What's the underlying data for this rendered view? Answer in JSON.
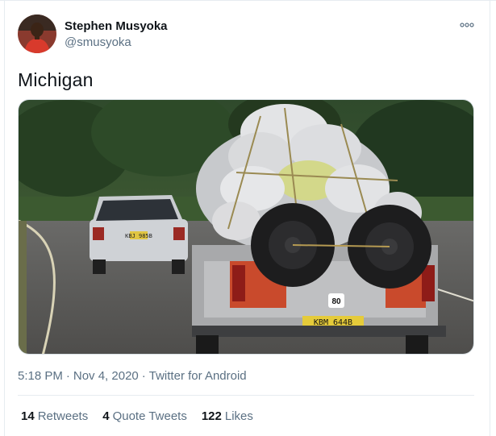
{
  "author": {
    "display_name": "Stephen Musyoka",
    "handle": "@smusyoka"
  },
  "more_icon": "ellipsis-icon",
  "tweet": {
    "text": "Michigan"
  },
  "media": {
    "plate_front_truck": "KBM 644B",
    "plate_car": "KBJ 985B",
    "speed_sticker": "80"
  },
  "meta": {
    "time": "5:18 PM",
    "separator1": "·",
    "date": "Nov 4, 2020",
    "separator2": "·",
    "source": "Twitter for Android"
  },
  "stats": [
    {
      "count": "14",
      "label": "Retweets"
    },
    {
      "count": "4",
      "label": "Quote Tweets"
    },
    {
      "count": "122",
      "label": "Likes"
    }
  ],
  "colors": {
    "text_primary": "#0f1419",
    "text_secondary": "#5b7083",
    "divider": "#e6ecf0"
  }
}
